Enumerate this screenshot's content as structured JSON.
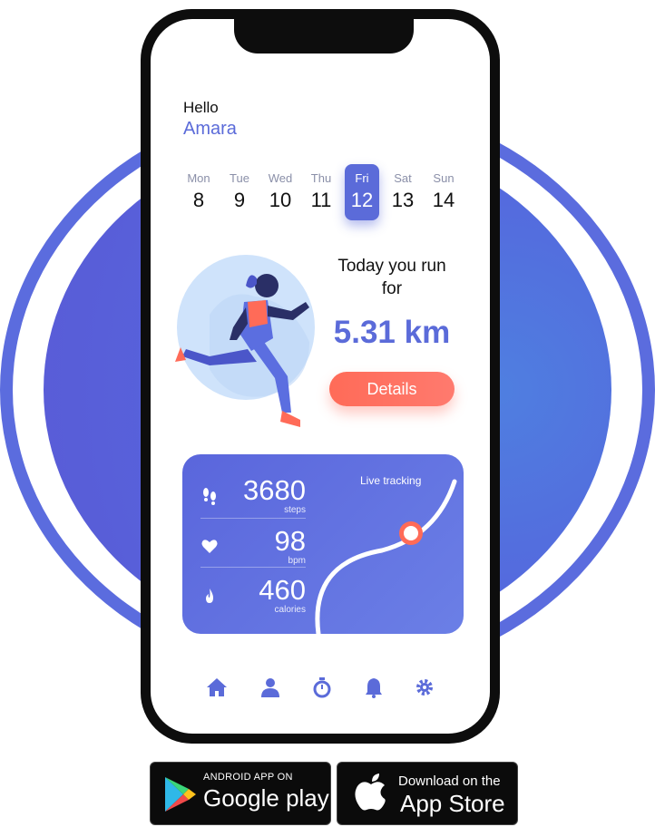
{
  "greeting": "Hello",
  "user_name": "Amara",
  "days": [
    {
      "name": "Mon",
      "date": "8"
    },
    {
      "name": "Tue",
      "date": "9"
    },
    {
      "name": "Wed",
      "date": "10"
    },
    {
      "name": "Thu",
      "date": "11"
    },
    {
      "name": "Fri",
      "date": "12",
      "selected": true
    },
    {
      "name": "Sat",
      "date": "13"
    },
    {
      "name": "Sun",
      "date": "14"
    }
  ],
  "run": {
    "title": "Today you run for",
    "distance": "5.31 km",
    "details_label": "Details"
  },
  "stats": {
    "live_label": "Live tracking",
    "items": [
      {
        "icon": "footsteps-icon",
        "value": "3680",
        "unit": "steps"
      },
      {
        "icon": "heart-icon",
        "value": "98",
        "unit": "bpm"
      },
      {
        "icon": "flame-icon",
        "value": "460",
        "unit": "calories"
      }
    ]
  },
  "nav": [
    "home-icon",
    "profile-icon",
    "stopwatch-icon",
    "bell-icon",
    "gear-icon"
  ],
  "badges": {
    "google": {
      "small": "ANDROID APP ON",
      "big": "Google play"
    },
    "apple": {
      "small": "Download on the",
      "big": "App Store"
    }
  },
  "colors": {
    "accent": "#5b6bd9",
    "button": "#ff6b58"
  }
}
